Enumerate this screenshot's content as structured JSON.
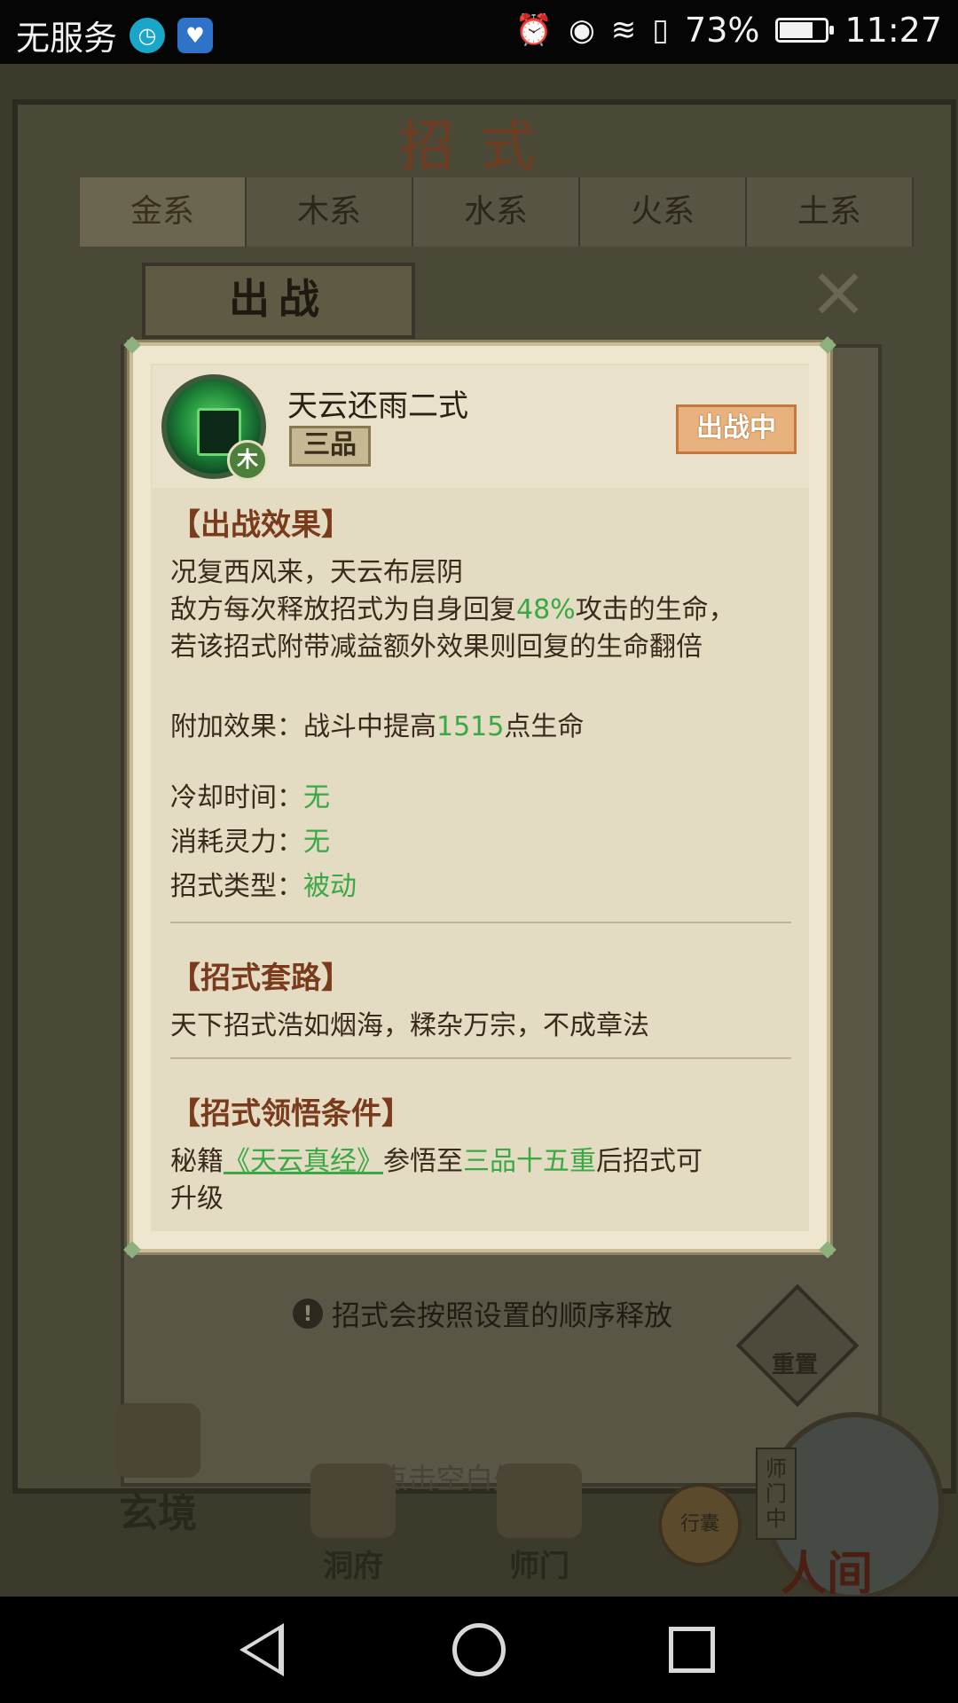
{
  "status_bar": {
    "carrier": "无服务",
    "battery_percent": "73%",
    "battery_level": 0.73,
    "time": "11:27",
    "icons": [
      "clock-app-icon",
      "health-app-icon",
      "alarm-icon",
      "eye-icon",
      "wifi-icon",
      "sim-icon",
      "battery-icon"
    ]
  },
  "background": {
    "screen_title": "招式",
    "element_tabs": [
      "金系",
      "木系",
      "水系",
      "火系",
      "土系"
    ],
    "active_tab": "金系",
    "section_header": "出战",
    "hint": "招式会按照设置的顺序释放",
    "reset_label": "重置",
    "return_hint": "点击空白处返回",
    "bottom_nav": [
      "玄境",
      "洞府",
      "师门"
    ],
    "pouch_label": "行囊",
    "world_label": "人间",
    "sect_tag": "师门中"
  },
  "dialog": {
    "skill_name": "天云还雨二式",
    "grade": "三品",
    "element": "木",
    "status": "出战中",
    "effect_title": "【出战效果】",
    "effect_line1": "况复西风来，天云布层阴",
    "effect_line2_a": "敌方每次释放招式为自身回复",
    "effect_line2_pct": "48%",
    "effect_line2_b": "攻击的生命，",
    "effect_line3": "若该招式附带减益额外效果则回复的生命翻倍",
    "bonus_label": "附加效果：战斗中提高",
    "bonus_value": "1515",
    "bonus_suffix": "点生命",
    "cooldown_label": "冷却时间：",
    "cooldown_value": "无",
    "cost_label": "消耗灵力：",
    "cost_value": "无",
    "type_label": "招式类型：",
    "type_value": "被动",
    "routine_title": "【招式套路】",
    "routine_text": "天下招式浩如烟海，糅杂万宗，不成章法",
    "condition_title": "【招式领悟条件】",
    "condition_prefix": "秘籍",
    "condition_book": "《天云真经》",
    "condition_mid": "参悟至",
    "condition_level": "三品十五重",
    "condition_suffix": "后招式可",
    "condition_line2": "升级"
  },
  "colors": {
    "accent_green": "#3aa844",
    "title_brown": "#7a3a1c",
    "status_orange": "#e8b27e"
  }
}
